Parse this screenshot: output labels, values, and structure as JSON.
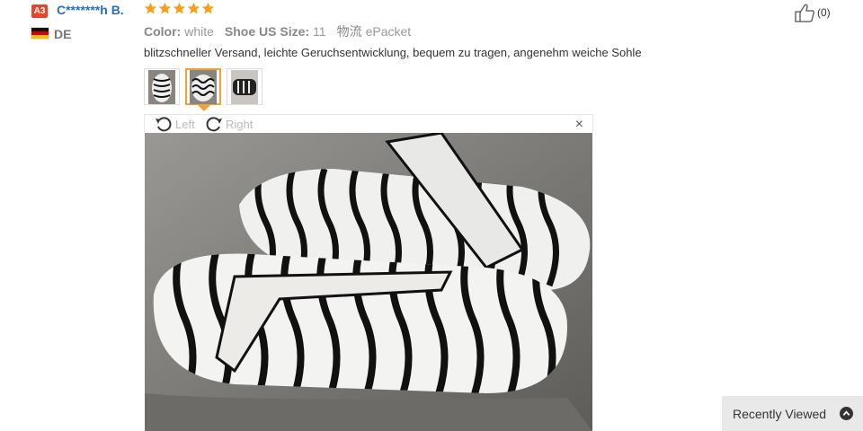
{
  "reviewer": {
    "level_badge": "A3",
    "name": "C*******h B.",
    "country": "DE",
    "rating": 5
  },
  "attributes": [
    {
      "label": "Color:",
      "value": "white"
    },
    {
      "label": "Shoe US Size:",
      "value": "11"
    },
    {
      "label": "物流",
      "value": "ePacket"
    }
  ],
  "review_text": "blitzschneller Versand, leichte Geruchsentwicklung, bequem zu tragen, angenehm weiche Sohle",
  "thumbnails": [
    {
      "icon": "sandal-photo-thumbnail",
      "selected": false
    },
    {
      "icon": "sandal-photo-thumbnail",
      "selected": true
    },
    {
      "icon": "sandal-photo-thumbnail",
      "selected": false
    }
  ],
  "viewer": {
    "rotate_left_label": "Left",
    "rotate_right_label": "Right",
    "close_label": "×"
  },
  "helpful": {
    "count_label": "(0)"
  },
  "recently_viewed": {
    "label": "Recently Viewed"
  },
  "colors": {
    "accent_orange": "#f4a037",
    "name_blue": "#2a6ebb",
    "badge_red": "#e8442c",
    "star_orange": "#f6a01a"
  }
}
